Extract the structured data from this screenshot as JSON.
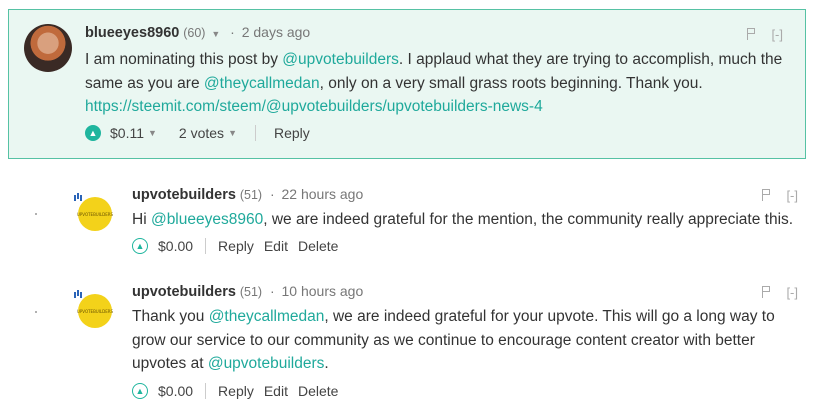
{
  "comments": [
    {
      "author": "blueeyes8960",
      "reputation": "(60)",
      "time": "2 days ago",
      "body_parts": [
        "I am nominating this post by ",
        "@upvotebuilders",
        ". I applaud what they are trying to accomplish, much the same as you are ",
        "@theycallmedan",
        ", only on a very small grass roots beginning. Thank you."
      ],
      "link": "https://steemit.com/steem/@upvotebuilders/upvotebuilders-news-4",
      "payout": "$0.11",
      "votes": "2 votes",
      "reply_label": "Reply",
      "collapse": "[-]"
    },
    {
      "author": "upvotebuilders",
      "reputation": "(51)",
      "time": "22 hours ago",
      "avatar_text": "UPVOTEBUILDERS",
      "body_parts": [
        "Hi ",
        "@blueeyes8960",
        ", we are indeed grateful for the mention, the community really appreciate this."
      ],
      "payout": "$0.00",
      "reply_label": "Reply",
      "edit_label": "Edit",
      "delete_label": "Delete",
      "collapse": "[-]"
    },
    {
      "author": "upvotebuilders",
      "reputation": "(51)",
      "time": "10 hours ago",
      "avatar_text": "UPVOTEBUILDERS",
      "body_parts": [
        "Thank you ",
        "@theycallmedan",
        ", we are indeed grateful for your upvote. This will go a long way to grow our service to our community as we continue to encourage content creator with better upvotes at ",
        "@upvotebuilders",
        "."
      ],
      "payout": "$0.00",
      "reply_label": "Reply",
      "edit_label": "Edit",
      "delete_label": "Delete",
      "collapse": "[-]"
    }
  ],
  "separator": "·",
  "colors": {
    "accent": "#1fa99b",
    "highlight_bg": "#eaf7f2",
    "highlight_border": "#56c2a4",
    "avatar_yellow": "#f3d21a"
  },
  "icons": [
    "upvote-icon",
    "caret-down-icon",
    "flag-icon"
  ]
}
